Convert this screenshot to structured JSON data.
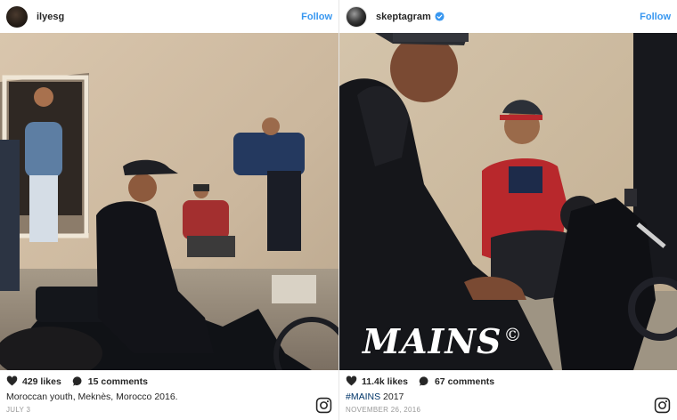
{
  "posts": [
    {
      "username": "ilyesg",
      "verified": false,
      "follow_label": "Follow",
      "likes": "429 likes",
      "comments": "15 comments",
      "caption": "Moroccan youth, Meknès, Morocco 2016.",
      "date": "JULY 3"
    },
    {
      "username": "skeptagram",
      "verified": true,
      "follow_label": "Follow",
      "overlay_text": "MAINS",
      "overlay_symbol": "©",
      "likes": "11.4k likes",
      "comments": "67 comments",
      "caption_tag": "#MAINS",
      "caption_rest": " 2017",
      "date": "NOVEMBER 26, 2016"
    }
  ],
  "icons": {
    "heart": "heart-icon",
    "comment": "comment-bubble-icon",
    "verified": "verified-badge-icon",
    "instagram": "instagram-logo-icon"
  },
  "colors": {
    "link_blue": "#3897f0",
    "text": "#262626",
    "muted": "#999999",
    "hashtag": "#003569"
  }
}
